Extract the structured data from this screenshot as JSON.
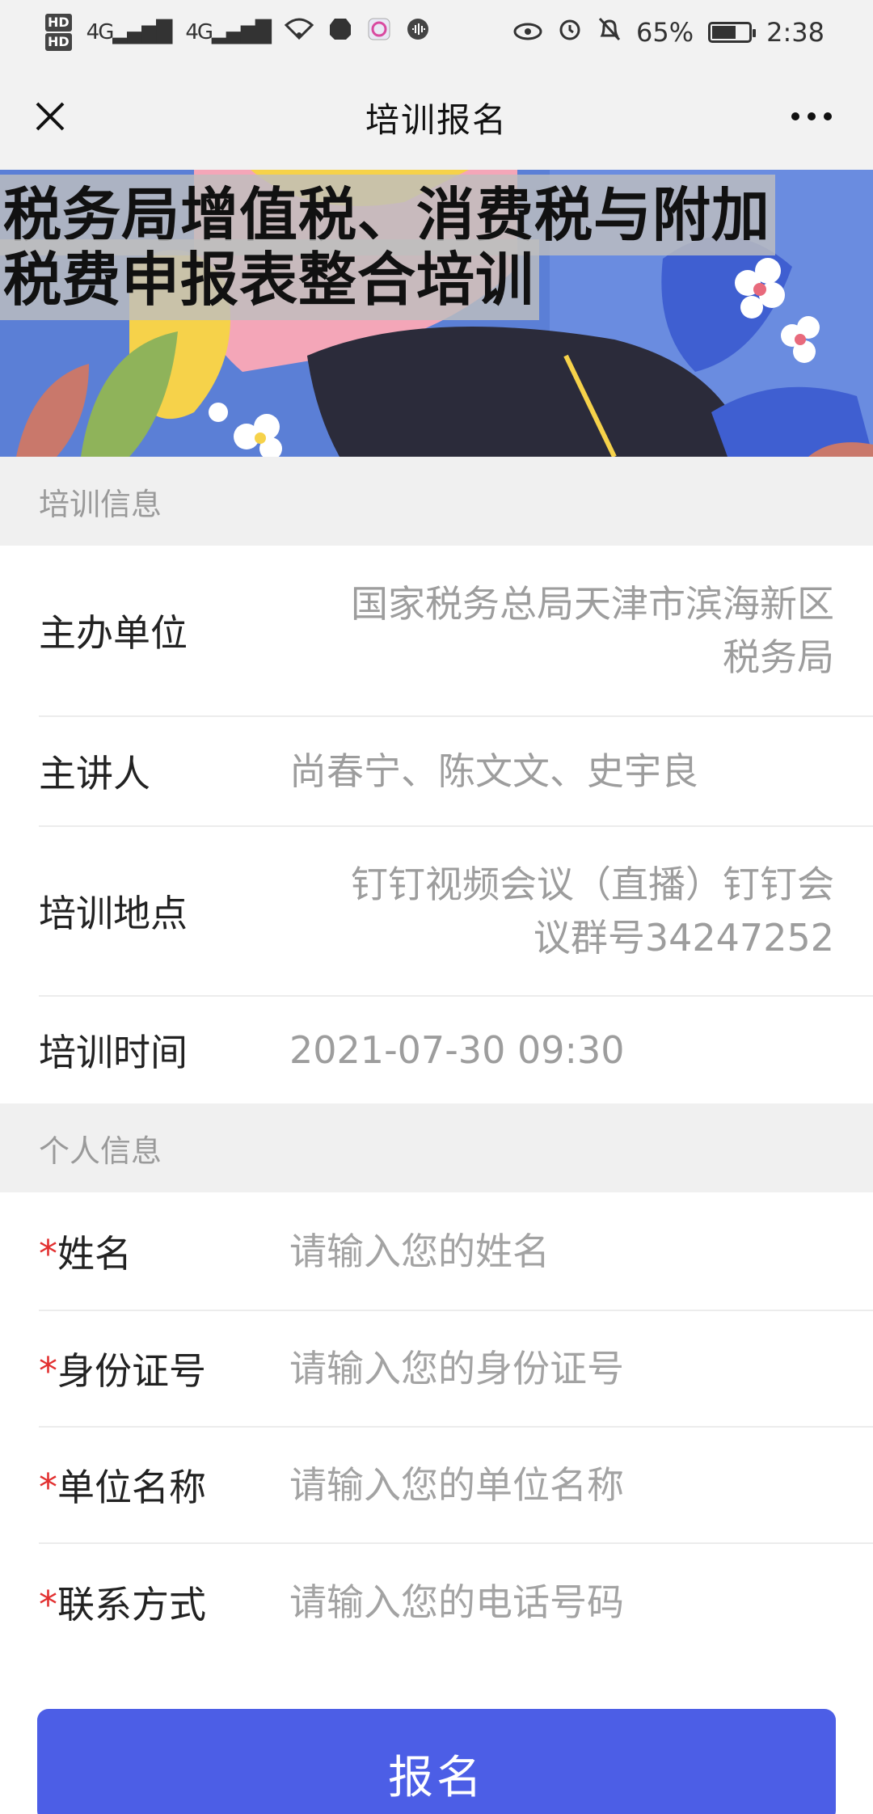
{
  "status_bar": {
    "hd1": "HD",
    "hd2": "HD",
    "signal1": "⁴ᴳ",
    "signal2": "⁴ᴳ",
    "battery_percent": "65%",
    "battery_level": 0.65,
    "time": "2:38"
  },
  "nav": {
    "title": "培训报名"
  },
  "banner": {
    "title_line1": "税务局增值税、消费税与附加",
    "title_line2": "税费申报表整合培训"
  },
  "training_info": {
    "section_title": "培训信息",
    "organizer_label": "主办单位",
    "organizer_value": "国家税务总局天津市滨海新区税务局",
    "lecturer_label": "主讲人",
    "lecturer_value": "尚春宁、陈文文、史宇良",
    "location_label": "培训地点",
    "location_value": "钉钉视频会议（直播）钉钉会议群号34247252",
    "time_label": "培训时间",
    "time_value": "2021-07-30 09:30"
  },
  "personal_info": {
    "section_title": "个人信息",
    "required_mark": "*",
    "name_label": "姓名",
    "name_placeholder": "请输入您的姓名",
    "id_label": "身份证号",
    "id_placeholder": "请输入您的身份证号",
    "org_label": "单位名称",
    "org_placeholder": "请输入您的单位名称",
    "contact_label": "联系方式",
    "contact_placeholder": "请输入您的电话号码"
  },
  "submit": {
    "label": "报名"
  }
}
